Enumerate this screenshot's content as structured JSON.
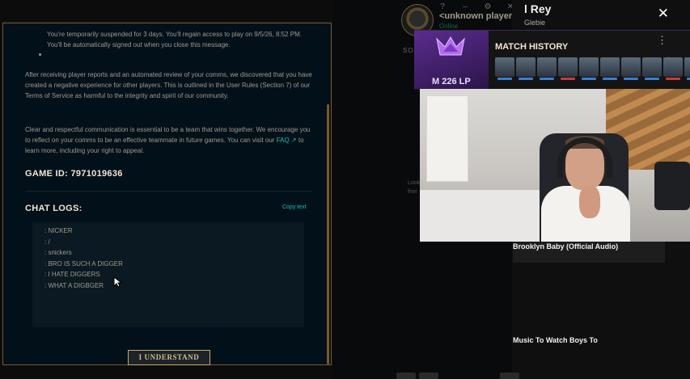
{
  "modal": {
    "bullet_text": "You're temporarily suspended for 3 days. You'll regain access to play on 9/5/26, 8:52 PM. You'll be automatically signed out when you close this message.",
    "paragraph1": "After receiving player reports and an automated review of your comms, we discovered that you have created a negative experience for other players. This is outlined in the User Rules (Section 7) of our Terms of Service as harmful to the integrity and spirit of our community.",
    "paragraph2_before_link": "Clear and respectful communication is essential to be a team that wins together. We encourage you to reflect on your comms to be an effective teammate in future games. You can visit our ",
    "faq_link": "FAQ ↗",
    "paragraph2_after_link": " to learn more, including your right to appeal.",
    "game_id": "GAME ID: 7971019636",
    "chat_logs_title": "CHAT LOGS:",
    "copy_text": "Copy text",
    "chat_lines": [
      ": NICKER",
      ": /",
      ": snickers",
      ": BRO IS SUCH A DIGGER",
      ": I HATE DIGGERS",
      ": WHAT A DIGBGER"
    ],
    "understand_button": "I UNDERSTAND"
  },
  "client": {
    "window_icons": [
      "?",
      "–",
      "⚙",
      "✕"
    ],
    "player_name": "<unknown player>",
    "status": "Online",
    "social_label": "SOU",
    "looking_label": "Look friei"
  },
  "youtube": {
    "title": "l Rey",
    "subtitle": "Glebie",
    "close_icon": "✕",
    "video1": "Brooklyn Baby (Official Audio)",
    "video2": "Music To Watch Boys To"
  },
  "match_history": {
    "title": "MATCH HISTORY",
    "rank_lp": "M 226 LP",
    "menu_icon": "⋮",
    "games": [
      {
        "result": "win"
      },
      {
        "result": "win"
      },
      {
        "result": "win"
      },
      {
        "result": "loss"
      },
      {
        "result": "win"
      },
      {
        "result": "win"
      },
      {
        "result": "win"
      },
      {
        "result": "win"
      },
      {
        "result": "loss"
      },
      {
        "result": "win"
      }
    ]
  }
}
